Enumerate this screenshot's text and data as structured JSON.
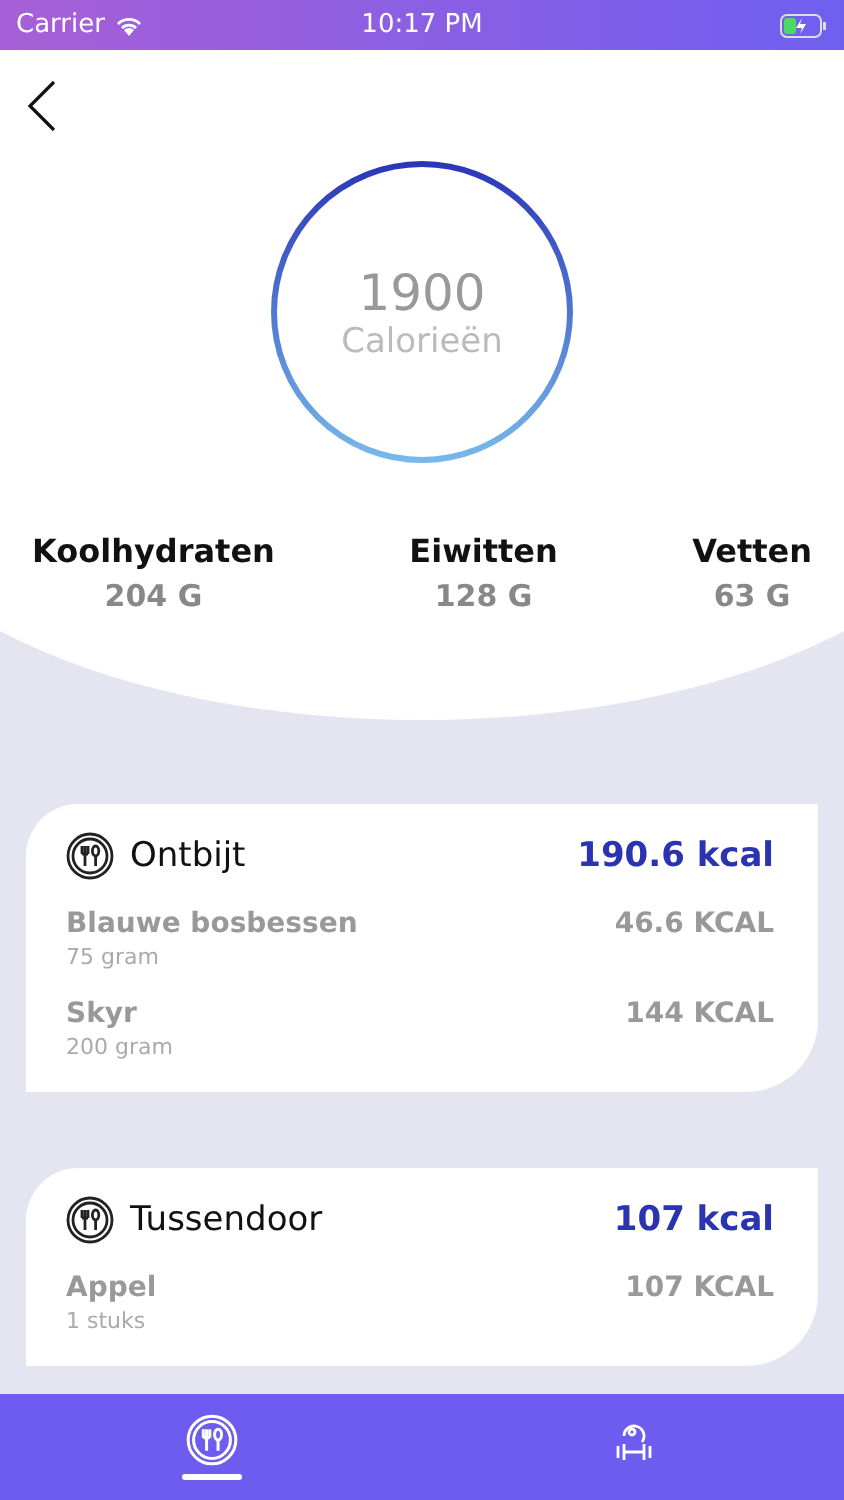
{
  "status_bar": {
    "carrier": "Carrier",
    "time": "10:17 PM"
  },
  "summary": {
    "value": "1900",
    "label": "Calorieën"
  },
  "macros": [
    {
      "name": "Koolhydraten",
      "amount": "204 G"
    },
    {
      "name": "Eiwitten",
      "amount": "128 G"
    },
    {
      "name": "Vetten",
      "amount": "63 G"
    }
  ],
  "meals": [
    {
      "name": "Ontbijt",
      "total": "190.6 kcal",
      "items": [
        {
          "name": "Blauwe bosbessen",
          "amount": "75 gram",
          "kcal": "46.6 KCAL"
        },
        {
          "name": "Skyr",
          "amount": "200 gram",
          "kcal": "144 KCAL"
        }
      ]
    },
    {
      "name": "Tussendoor",
      "total": "107 kcal",
      "items": [
        {
          "name": "Appel",
          "amount": "1 stuks",
          "kcal": "107 KCAL"
        }
      ]
    }
  ],
  "tabs": [
    {
      "kind": "food",
      "selected": true
    },
    {
      "kind": "fitness",
      "selected": false
    }
  ]
}
